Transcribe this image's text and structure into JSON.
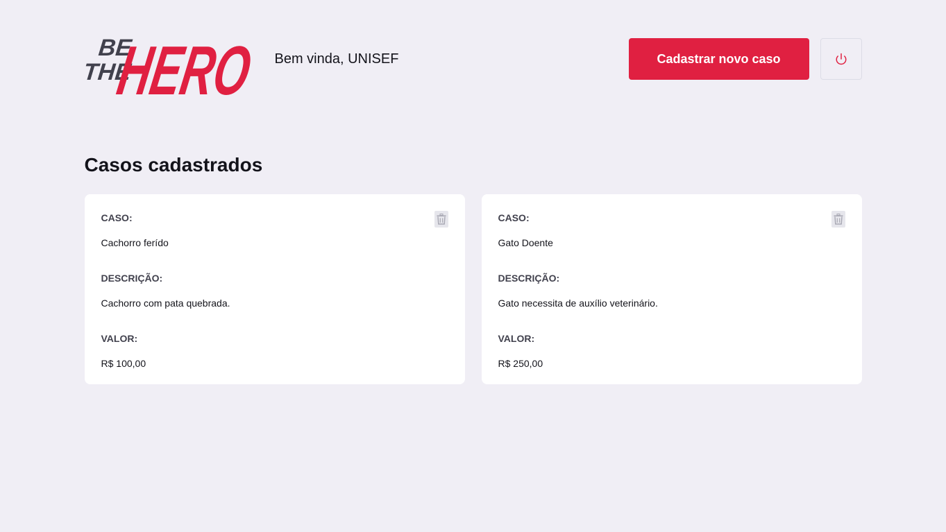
{
  "brand": {
    "logo_line1": "BE",
    "logo_line2": "THE",
    "logo_main": "HERO",
    "accent_color": "#e02041",
    "dark_color": "#41414d"
  },
  "header": {
    "welcome_text": "Bem vinda, UNISEF",
    "new_case_label": "Cadastrar novo caso",
    "logout_icon": "power-icon"
  },
  "main": {
    "title": "Casos cadastrados",
    "cases": [
      {
        "case_label": "CASO:",
        "case_value": "Cachorro ferído",
        "description_label": "DESCRIÇÃO:",
        "description_value": "Cachorro com pata quebrada.",
        "value_label": "VALOR:",
        "value_value": "R$ 100,00",
        "delete_icon": "trash-icon"
      },
      {
        "case_label": "CASO:",
        "case_value": "Gato Doente",
        "description_label": "DESCRIÇÃO:",
        "description_value": "Gato necessita de auxílio veterinário.",
        "value_label": "VALOR:",
        "value_value": "R$ 250,00",
        "delete_icon": "trash-icon"
      }
    ]
  }
}
